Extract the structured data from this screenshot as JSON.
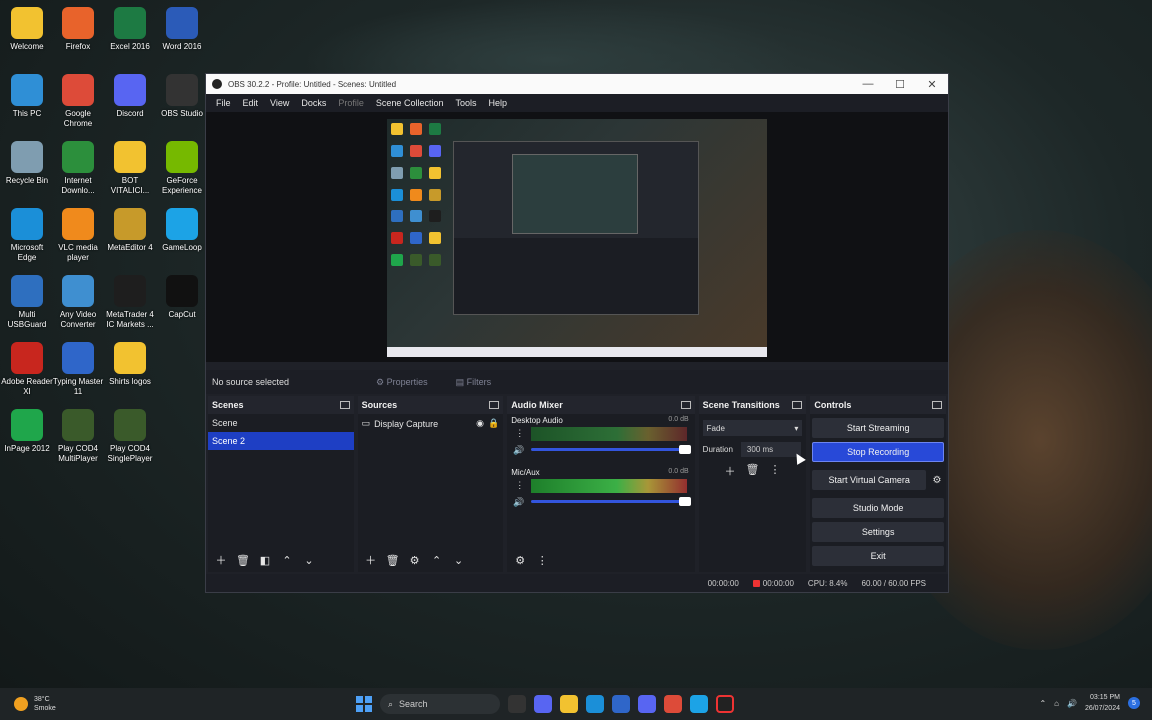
{
  "desktop": {
    "icons": [
      {
        "label": "Welcome",
        "icon": "folder-icon",
        "color": "#f2c230"
      },
      {
        "label": "Firefox",
        "icon": "firefox-icon",
        "color": "#e8632b"
      },
      {
        "label": "Excel 2016",
        "icon": "excel-icon",
        "color": "#1d7a43"
      },
      {
        "label": "Word 2016",
        "icon": "word-icon",
        "color": "#2b5bb8"
      },
      {
        "label": "This PC",
        "icon": "monitor-icon",
        "color": "#2f8fd6"
      },
      {
        "label": "Google Chrome",
        "icon": "chrome-icon",
        "color": "#dd4b39"
      },
      {
        "label": "Discord",
        "icon": "discord-icon",
        "color": "#5865f2"
      },
      {
        "label": "OBS Studio",
        "icon": "obs-icon",
        "color": "#333333"
      },
      {
        "label": "Recycle Bin",
        "icon": "recycle-bin-icon",
        "color": "#7f9db0"
      },
      {
        "label": "Internet Downlo...",
        "icon": "idm-icon",
        "color": "#2c8f3c"
      },
      {
        "label": "BOT VITALICI...",
        "icon": "folder-icon",
        "color": "#f2c230"
      },
      {
        "label": "GeForce Experience",
        "icon": "geforce-icon",
        "color": "#76b900"
      },
      {
        "label": "Microsoft Edge",
        "icon": "edge-icon",
        "color": "#1b8fd8"
      },
      {
        "label": "VLC media player",
        "icon": "vlc-icon",
        "color": "#f08a1c"
      },
      {
        "label": "MetaEditor 4",
        "icon": "metaeditor-icon",
        "color": "#c79a2a"
      },
      {
        "label": "GameLoop",
        "icon": "gameloop-icon",
        "color": "#1ca3e6"
      },
      {
        "label": "Multi USBGuard",
        "icon": "usbguard-icon",
        "color": "#2e6fbf"
      },
      {
        "label": "Any Video Converter",
        "icon": "video-converter-icon",
        "color": "#3f8fd0"
      },
      {
        "label": "MetaTrader 4 IC Markets ...",
        "icon": "metatrader-icon",
        "color": "#1e1e1e"
      },
      {
        "label": "CapCut",
        "icon": "capcut-icon",
        "color": "#111111"
      },
      {
        "label": "Adobe Reader XI",
        "icon": "adobe-reader-icon",
        "color": "#c8261e"
      },
      {
        "label": "Typing Master 11",
        "icon": "typing-master-icon",
        "color": "#2f66c9"
      },
      {
        "label": "Shirts logos",
        "icon": "folder-icon",
        "color": "#f2c230"
      },
      {
        "label": "",
        "icon": "blank-icon",
        "color": "transparent"
      },
      {
        "label": "InPage 2012",
        "icon": "inpage-icon",
        "color": "#1fa64b"
      },
      {
        "label": "Play COD4 MultiPlayer",
        "icon": "cod4-icon",
        "color": "#3a5a2a"
      },
      {
        "label": "Play COD4 SinglePlayer",
        "icon": "cod4-icon",
        "color": "#3a5a2a"
      }
    ]
  },
  "window": {
    "title": "OBS 30.2.2 - Profile: Untitled - Scenes: Untitled",
    "minimize": "—",
    "maximize": "☐",
    "close": "✕"
  },
  "menu": [
    "File",
    "Edit",
    "View",
    "Docks",
    "Profile",
    "Scene Collection",
    "Tools",
    "Help"
  ],
  "source_bar": {
    "status": "No source selected",
    "properties": "Properties",
    "filters": "Filters"
  },
  "scenes": {
    "title": "Scenes",
    "items": [
      "Scene",
      "Scene 2"
    ],
    "selected": "Scene 2"
  },
  "sources": {
    "title": "Sources",
    "items": [
      "Display Capture"
    ]
  },
  "mixer": {
    "title": "Audio Mixer",
    "channels": [
      {
        "name": "Desktop Audio",
        "db": "0.0 dB"
      },
      {
        "name": "Mic/Aux",
        "db": "0.0 dB"
      }
    ],
    "scale": "-60 -55 -50 -45 -40 -35 -30 -25 -20 -15 -10 -5 0"
  },
  "transitions": {
    "title": "Scene Transitions",
    "selected": "Fade",
    "duration_label": "Duration",
    "duration_value": "300 ms"
  },
  "controls": {
    "title": "Controls",
    "buttons": [
      "Start Streaming",
      "Stop Recording",
      "Start Virtual Camera",
      "Studio Mode",
      "Settings",
      "Exit"
    ]
  },
  "status": {
    "stream_time": "00:00:00",
    "rec_time": "00:00:00",
    "cpu": "CPU: 8.4%",
    "fps": "60.00 / 60.00 FPS"
  },
  "taskbar": {
    "weather_temp": "38°C",
    "weather_desc": "Smoke",
    "search_placeholder": "Search",
    "time": "03:15 PM",
    "date": "26/07/2024",
    "notifications": "5"
  }
}
